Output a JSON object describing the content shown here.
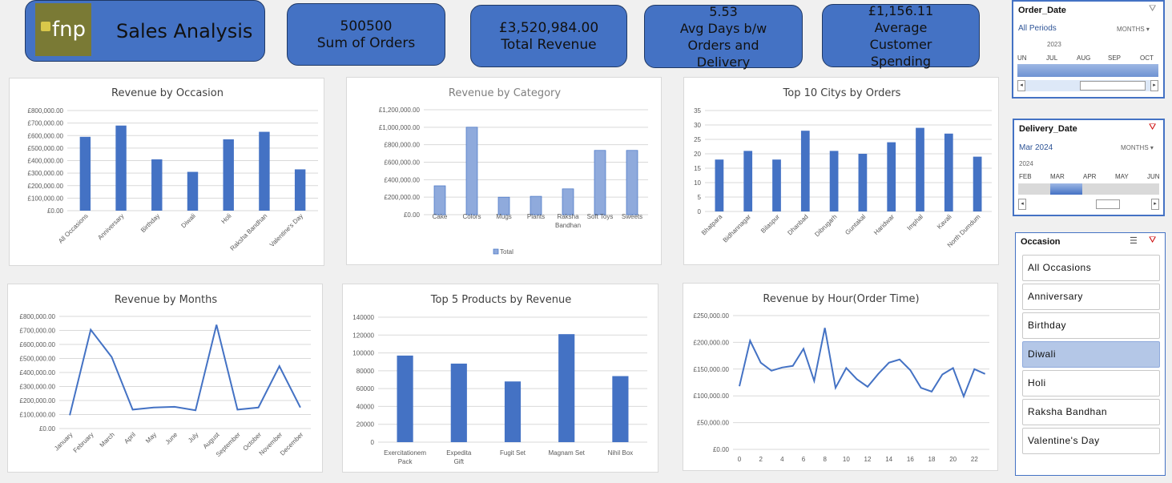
{
  "header": {
    "logo_text": "fnp",
    "title": "Sales Analysis"
  },
  "kpis": [
    {
      "value": "500500",
      "label": "Sum of Orders"
    },
    {
      "value": "£3,520,984.00",
      "label": "Total Revenue"
    },
    {
      "value": "5.53",
      "label": "Avg Days b/w Orders and Delivery"
    },
    {
      "value": "£1,156.11",
      "label": "Average Customer Spending"
    }
  ],
  "slicers": {
    "order_date": {
      "title": "Order_Date",
      "period": "All Periods",
      "unit": "MONTHS",
      "year": "2023",
      "months": [
        "UN",
        "JUL",
        "AUG",
        "SEP",
        "OCT"
      ]
    },
    "delivery_date": {
      "title": "Delivery_Date",
      "period": "Mar 2024",
      "unit": "MONTHS",
      "year": "2024",
      "months": [
        "FEB",
        "MAR",
        "APR",
        "MAY",
        "JUN"
      ]
    },
    "occasion": {
      "title": "Occasion",
      "items": [
        "All Occasions",
        "Anniversary",
        "Birthday",
        "Diwali",
        "Holi",
        "Raksha Bandhan",
        "Valentine's Day"
      ],
      "selected": "Diwali"
    }
  },
  "accent_color": "#4472c4",
  "chart_data": [
    {
      "id": "occasion",
      "type": "bar",
      "title": "Revenue by Occasion",
      "categories": [
        "All Occasions",
        "Anniversary",
        "Birthday",
        "Diwali",
        "Holi",
        "Raksha Bandhan",
        "Valentine's Day"
      ],
      "values": [
        590000,
        680000,
        410000,
        310000,
        570000,
        630000,
        330000
      ],
      "ylim": [
        0,
        800000
      ],
      "yticks": [
        "£0.00",
        "£100,000.00",
        "£200,000.00",
        "£300,000.00",
        "£400,000.00",
        "£500,000.00",
        "£600,000.00",
        "£700,000.00",
        "£800,000.00"
      ]
    },
    {
      "id": "category",
      "type": "bar",
      "title": "Revenue by Category",
      "categories": [
        "Cake",
        "Colors",
        "Mugs",
        "Plants",
        "Raksha Bandhan",
        "Soft Toys",
        "Sweets"
      ],
      "values": [
        330000,
        1000000,
        200000,
        210000,
        295000,
        735000,
        735000
      ],
      "ylim": [
        0,
        1200000
      ],
      "yticks": [
        "£0.00",
        "£200,000.00",
        "£400,000.00",
        "£600,000.00",
        "£800,000.00",
        "£1,000,000.00",
        "£1,200,000.00"
      ],
      "legend": "Total"
    },
    {
      "id": "city",
      "type": "bar",
      "title": "Top 10 Citys by Orders",
      "categories": [
        "Bhatpara",
        "Bidhannagar",
        "Bilaspur",
        "Dhanbad",
        "Dibrugarh",
        "Guntakal",
        "Haridwar",
        "Imphal",
        "Kavali",
        "North Dumdum"
      ],
      "values": [
        18,
        21,
        18,
        28,
        21,
        20,
        24,
        29,
        27,
        19
      ],
      "ylim": [
        0,
        35
      ],
      "yticks": [
        "0",
        "5",
        "10",
        "15",
        "20",
        "25",
        "30",
        "35"
      ]
    },
    {
      "id": "months",
      "type": "line",
      "title": "Revenue by Months",
      "categories": [
        "January",
        "February",
        "March",
        "April",
        "May",
        "June",
        "July",
        "August",
        "September",
        "October",
        "November",
        "December"
      ],
      "values": [
        95000,
        705000,
        510000,
        135000,
        150000,
        155000,
        130000,
        740000,
        135000,
        150000,
        445000,
        150000
      ],
      "ylim": [
        0,
        800000
      ],
      "yticks": [
        "£0.00",
        "£100,000.00",
        "£200,000.00",
        "£300,000.00",
        "£400,000.00",
        "£500,000.00",
        "£600,000.00",
        "£700,000.00",
        "£800,000.00"
      ]
    },
    {
      "id": "products",
      "type": "bar",
      "title": "Top 5 Products by Revenue",
      "categories": [
        "Exercitationem Pack",
        "Expedita Gift",
        "Fugit Set",
        "Magnam Set",
        "Nihil Box"
      ],
      "values": [
        97000,
        88000,
        68000,
        121000,
        74000
      ],
      "ylim": [
        0,
        140000
      ],
      "yticks": [
        "0",
        "20000",
        "40000",
        "60000",
        "80000",
        "100000",
        "120000",
        "140000"
      ]
    },
    {
      "id": "hour",
      "type": "line",
      "title": "Revenue by Hour(Order Time)",
      "x": [
        0,
        1,
        2,
        3,
        4,
        5,
        6,
        7,
        8,
        9,
        10,
        11,
        12,
        13,
        14,
        15,
        16,
        17,
        18,
        19,
        20,
        21,
        22,
        23
      ],
      "values": [
        118000,
        203000,
        162000,
        147000,
        153000,
        156000,
        188000,
        128000,
        227000,
        115000,
        152000,
        131000,
        117000,
        141000,
        162000,
        168000,
        148000,
        115000,
        108000,
        140000,
        152000,
        99000,
        150000,
        141000
      ],
      "ylim": [
        0,
        250000
      ],
      "yticks": [
        "£0.00",
        "£50,000.00",
        "£100,000.00",
        "£150,000.00",
        "£200,000.00",
        "£250,000.00"
      ],
      "xticks": [
        "0",
        "2",
        "4",
        "6",
        "8",
        "10",
        "12",
        "14",
        "16",
        "18",
        "20",
        "22"
      ]
    }
  ]
}
